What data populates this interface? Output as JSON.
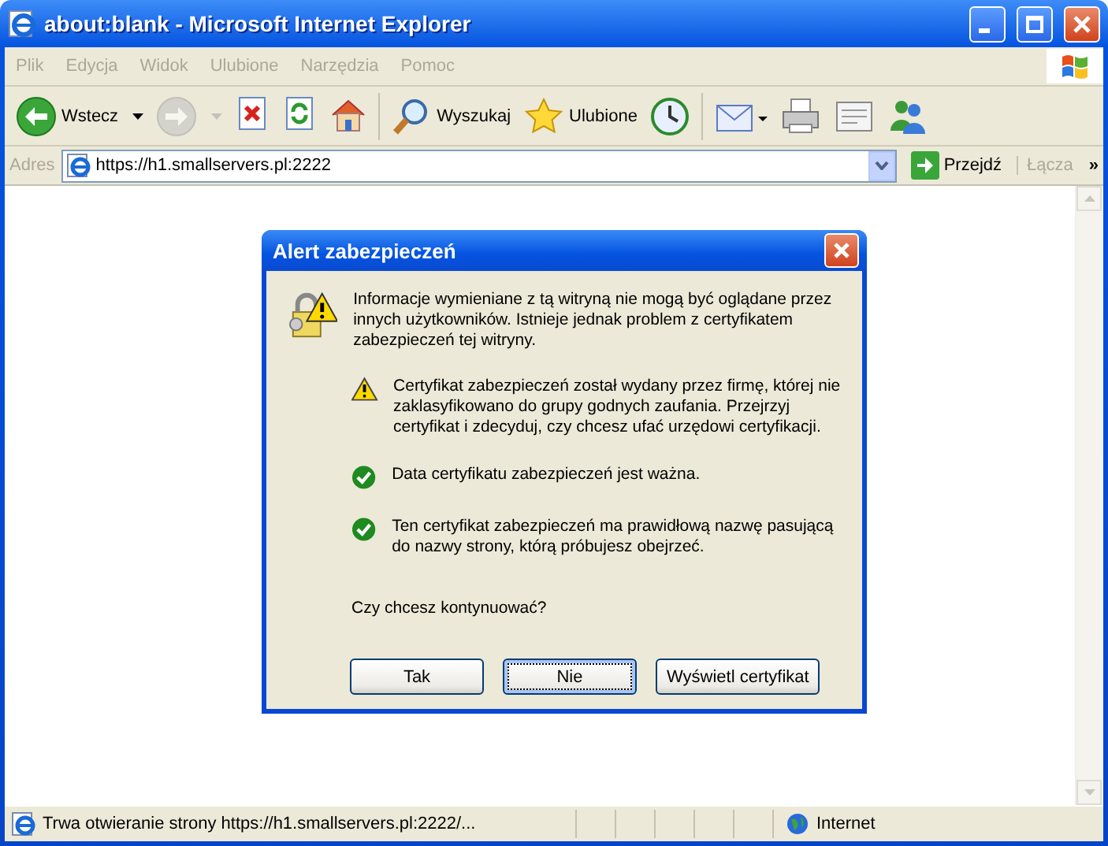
{
  "window": {
    "title": "about:blank - Microsoft Internet Explorer"
  },
  "menu": [
    "Plik",
    "Edycja",
    "Widok",
    "Ulubione",
    "Narzędzia",
    "Pomoc"
  ],
  "toolbar": [
    {
      "kind": "back",
      "label": "Wstecz",
      "disabled": false
    },
    {
      "kind": "forward",
      "disabled": true
    },
    {
      "kind": "stop",
      "disabled": false
    },
    {
      "kind": "refresh",
      "disabled": false
    },
    {
      "kind": "home",
      "disabled": false
    },
    {
      "kind": "search",
      "label": "Wyszukaj",
      "disabled": false
    },
    {
      "kind": "favorites",
      "label": "Ulubione",
      "disabled": false
    },
    {
      "kind": "history",
      "disabled": false
    },
    {
      "kind": "mail",
      "disabled": false
    },
    {
      "kind": "print",
      "disabled": false
    },
    {
      "kind": "edit",
      "disabled": false
    },
    {
      "kind": "messenger",
      "disabled": false
    }
  ],
  "address": {
    "label": "Adres",
    "value": "https://h1.smallservers.pl:2222",
    "go": "Przejdź",
    "links": "Łącza",
    "more": "»"
  },
  "dialog": {
    "title": "Alert zabezpieczeń",
    "intro": "Informacje wymieniane z tą witryną nie mogą być oglądane przez innych użytkowników. Istnieje jednak problem z certyfikatem zabezpieczeń tej witryny.",
    "items": [
      {
        "kind": "warning",
        "text": "Certyfikat zabezpieczeń został wydany przez firmę, której nie zaklasyfikowano do grupy godnych zaufania. Przejrzyj certyfikat i zdecyduj, czy chcesz ufać urzędowi certyfikacji."
      },
      {
        "kind": "ok",
        "text": "Data certyfikatu zabezpieczeń jest ważna."
      },
      {
        "kind": "ok",
        "text": "Ten certyfikat zabezpieczeń ma prawidłową nazwę pasującą do nazwy strony, którą próbujesz obejrzeć."
      }
    ],
    "question": "Czy chcesz kontynuować?",
    "buttons": [
      {
        "label": "Tak",
        "selected": false
      },
      {
        "label": "Nie",
        "selected": true
      },
      {
        "label": "Wyświetl certyfikat",
        "selected": false
      }
    ]
  },
  "status_bar": {
    "text": "Trwa otwieranie strony https://h1.smallservers.pl:2222/...",
    "zone": "Internet"
  }
}
